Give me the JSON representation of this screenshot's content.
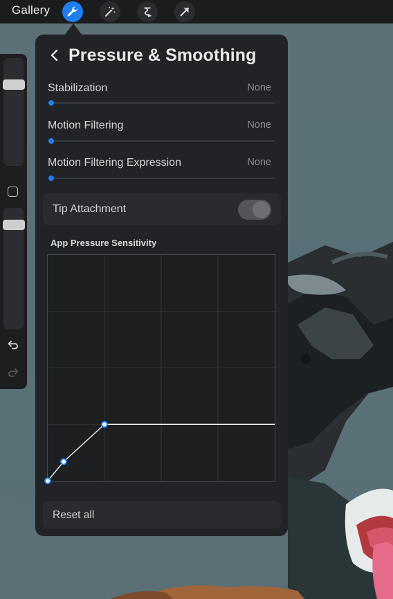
{
  "topbar": {
    "gallery_label": "Gallery",
    "tools": [
      {
        "icon": "wrench-icon",
        "active": true
      },
      {
        "icon": "magic-wand-icon",
        "active": false
      },
      {
        "icon": "selection-icon",
        "active": false
      },
      {
        "icon": "transform-arrow-icon",
        "active": false
      }
    ]
  },
  "sidebar": {
    "brush_size_level": 0.16,
    "opacity_level": 0.13,
    "undo_icon": "undo-icon",
    "redo_icon": "redo-icon"
  },
  "panel": {
    "title": "Pressure & Smoothing",
    "rows": [
      {
        "label": "Stabilization",
        "value": "None",
        "level": 0
      },
      {
        "label": "Motion Filtering",
        "value": "None",
        "level": 0
      },
      {
        "label": "Motion Filtering Expression",
        "value": "None",
        "level": 0
      }
    ],
    "tip_attachment": {
      "label": "Tip Attachment",
      "enabled": false
    },
    "pressure_section_label": "App Pressure Sensitivity",
    "pressure_curve": {
      "grid_divisions": 4,
      "points": [
        [
          0,
          0
        ],
        [
          0.07,
          0.085
        ],
        [
          0.25,
          0.25
        ],
        [
          1,
          0.25
        ]
      ]
    },
    "reset_label": "Reset all"
  },
  "colors": {
    "accent": "#1e7ef2",
    "panel_bg": "#222326",
    "topbar_bg": "#1b1c1e",
    "canvas_bg": "#5d7178"
  }
}
